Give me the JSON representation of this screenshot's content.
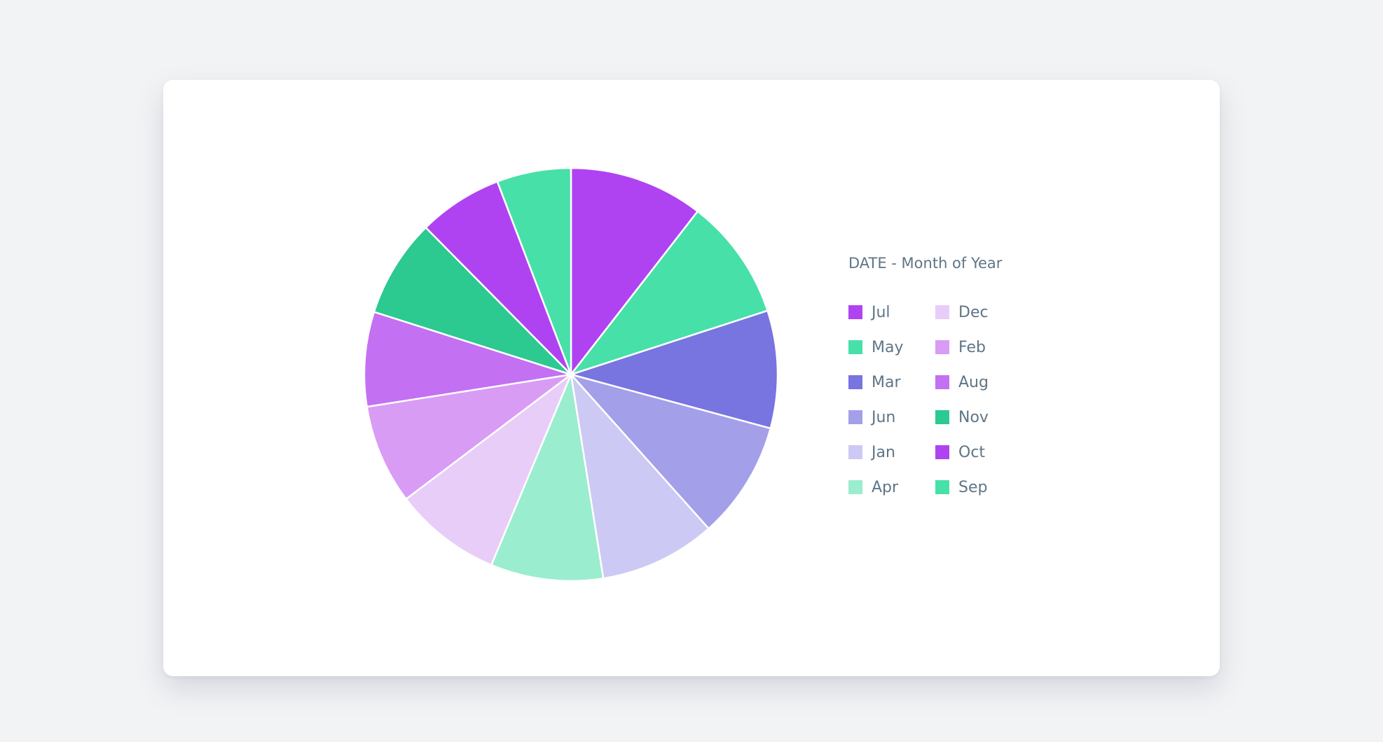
{
  "chart_data": {
    "type": "pie",
    "title": "",
    "legend_title": "DATE - Month of Year",
    "legend_position": "right",
    "start_angle_deg": 0,
    "direction": "clockwise",
    "slices": [
      {
        "label": "Jul",
        "value": 10.5,
        "color": "#b043f1"
      },
      {
        "label": "May",
        "value": 9.5,
        "color": "#47e0a8"
      },
      {
        "label": "Mar",
        "value": 9.2,
        "color": "#7874e0"
      },
      {
        "label": "Jun",
        "value": 9.2,
        "color": "#a39fe8"
      },
      {
        "label": "Jan",
        "value": 9.1,
        "color": "#cccaf4"
      },
      {
        "label": "Apr",
        "value": 8.8,
        "color": "#9aedcf"
      },
      {
        "label": "Dec",
        "value": 8.4,
        "color": "#e8cdf8"
      },
      {
        "label": "Feb",
        "value": 7.8,
        "color": "#d89cf5"
      },
      {
        "label": "Aug",
        "value": 7.4,
        "color": "#c370f2"
      },
      {
        "label": "Nov",
        "value": 7.7,
        "color": "#2cc990"
      },
      {
        "label": "Oct",
        "value": 6.6,
        "color": "#b043f1"
      },
      {
        "label": "Sep",
        "value": 5.8,
        "color": "#47e0a8"
      }
    ]
  }
}
